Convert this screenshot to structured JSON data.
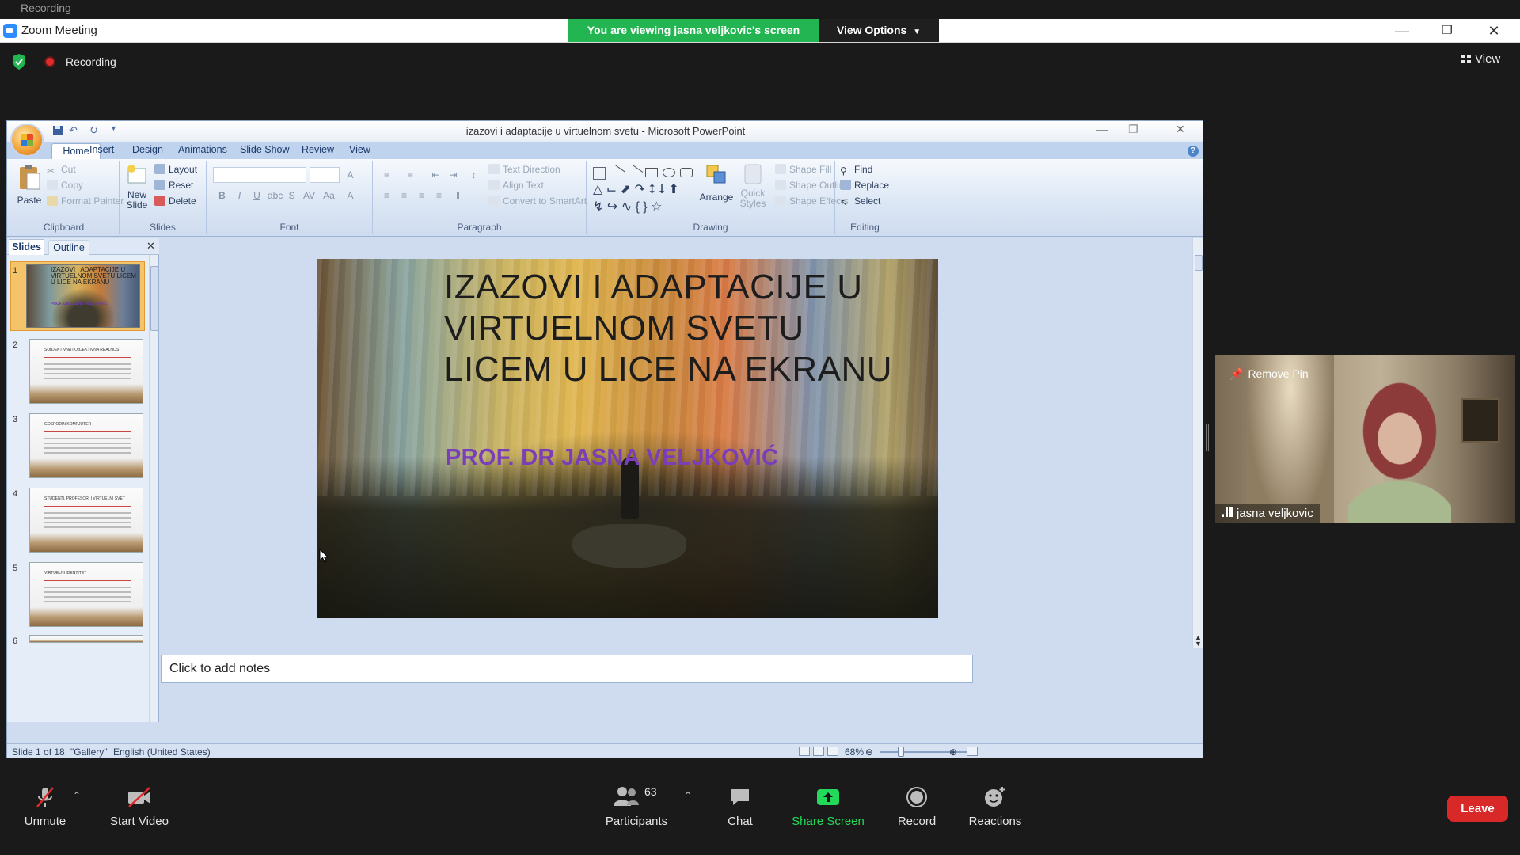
{
  "zoom": {
    "window_title": "Zoom Meeting",
    "ghost_recording": "Recording",
    "banner": "You are viewing jasna veljkovic's screen",
    "view_options": "View Options",
    "recording_label": "Recording",
    "view_label": "View",
    "controls": {
      "unmute": "Unmute",
      "start_video": "Start Video",
      "participants": "Participants",
      "participants_count": "63",
      "chat": "Chat",
      "share_screen": "Share Screen",
      "record": "Record",
      "reactions": "Reactions",
      "leave": "Leave"
    },
    "video": {
      "remove_pin": "Remove Pin",
      "name": "jasna veljkovic"
    }
  },
  "ppt": {
    "window_title": "izazovi i adaptacije u virtuelnom svetu - Microsoft PowerPoint",
    "tabs": [
      "Home",
      "Insert",
      "Design",
      "Animations",
      "Slide Show",
      "Review",
      "View"
    ],
    "clipboard": {
      "paste": "Paste",
      "cut": "Cut",
      "copy": "Copy",
      "format_painter": "Format Painter",
      "label": "Clipboard"
    },
    "slides_group": {
      "new_slide": "New",
      "new_slide2": "Slide",
      "layout": "Layout",
      "reset": "Reset",
      "delete": "Delete",
      "label": "Slides"
    },
    "font_group": {
      "label": "Font"
    },
    "paragraph": {
      "text_direction": "Text Direction",
      "align_text": "Align Text",
      "convert": "Convert to SmartArt",
      "label": "Paragraph"
    },
    "drawing": {
      "arrange": "Arrange",
      "quick": "Quick",
      "styles": "Styles",
      "shape_fill": "Shape Fill",
      "shape_outline": "Shape Outline",
      "shape_effects": "Shape Effects",
      "label": "Drawing"
    },
    "editing": {
      "find": "Find",
      "replace": "Replace",
      "select": "Select",
      "label": "Editing"
    },
    "pane": {
      "slides_tab": "Slides",
      "outline_tab": "Outline"
    },
    "thumbs": [
      {
        "num": "1",
        "title": "IZAZOVI I ADAPTACIJE U VIRTUELNOM SVETU LICEM U LICE NA EKRANU",
        "sub": "PROF. DR JASNA VELJKOVIĆ"
      },
      {
        "num": "2",
        "title": "SUBJEKTIVNA I OBJEKTIVNA REALNOST"
      },
      {
        "num": "3",
        "title": "GOSPODIN KOMPJUTER"
      },
      {
        "num": "4",
        "title": "STUDENTI, PROFESORI I VIRTUELNI SVET"
      },
      {
        "num": "5",
        "title": "VIRTUELNI IDENTITET"
      },
      {
        "num": "6",
        "title": ""
      }
    ],
    "slide": {
      "title": "IZAZOVI I ADAPTACIJE U VIRTUELNOM SVETU LICEM U LICE NA EKRANU",
      "subtitle": "PROF. DR JASNA VELJKOVIĆ"
    },
    "notes_placeholder": "Click to add notes",
    "status": {
      "slide_of": "Slide 1 of 18",
      "theme": "\"Gallery\"",
      "language": "English (United States)",
      "zoom": "68%"
    }
  },
  "colors": {
    "banner_green": "#23b551",
    "share_green": "#23d959",
    "leave_red": "#d92828",
    "subtitle_purple": "#7a3fb8"
  }
}
